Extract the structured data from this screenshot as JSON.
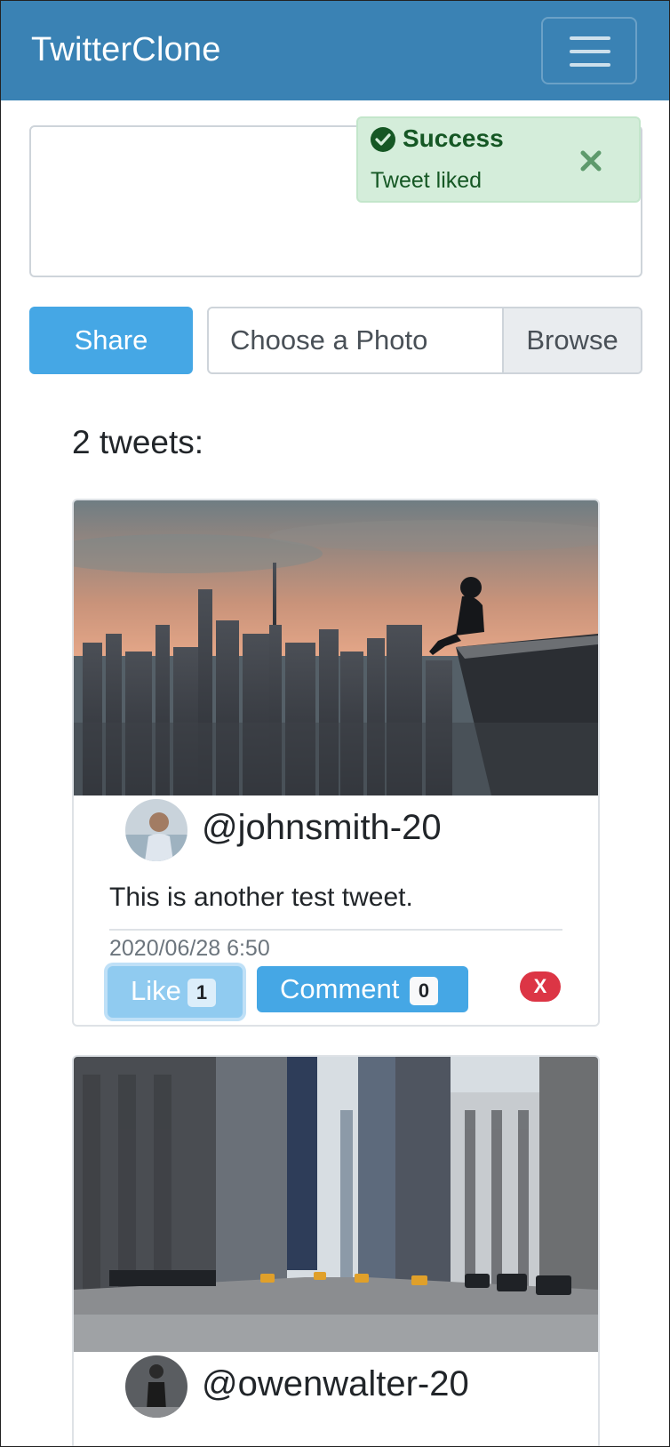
{
  "navbar": {
    "brand": "TwitterClone",
    "menu_icon": "hamburger-menu-icon",
    "color": "#3a82b4"
  },
  "compose": {
    "textarea_value": "",
    "share_label": "Share",
    "photo_placeholder": "Choose a Photo",
    "browse_label": "Browse"
  },
  "toast": {
    "title": "Success",
    "message": "Tweet liked",
    "icon": "check-circle-icon",
    "close_icon": "close-icon"
  },
  "feed": {
    "count_label": "2 tweets:",
    "tweets": [
      {
        "image": "city-skyline-photo",
        "avatar": "user-avatar",
        "handle": "@johnsmith-20",
        "text": "This is another test tweet.",
        "timestamp": "2020/06/28 6:50",
        "like_label": "Like",
        "like_count": "1",
        "comment_label": "Comment",
        "comment_count": "0",
        "delete_label": "X"
      },
      {
        "image": "city-street-photo",
        "avatar": "user-avatar",
        "handle": "@owenwalter-20"
      }
    ]
  },
  "colors": {
    "primary": "#45a7e5",
    "success_bg": "#d4edda",
    "danger": "#dc3545"
  }
}
